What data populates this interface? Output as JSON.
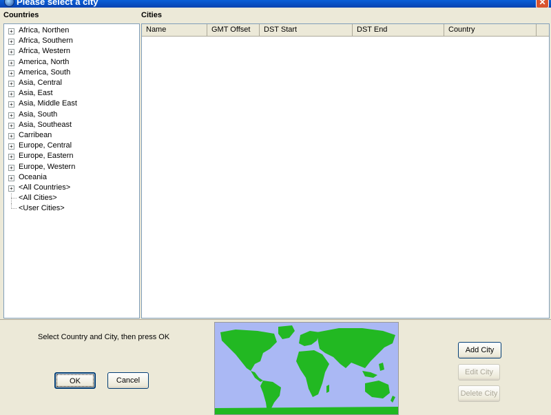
{
  "window": {
    "title": "Please select a city",
    "close_label": "✕"
  },
  "countries_pane": {
    "label": "Countries",
    "items": [
      {
        "label": "Africa, Northen",
        "expandable": true
      },
      {
        "label": "Africa, Southern",
        "expandable": true
      },
      {
        "label": "Africa, Western",
        "expandable": true
      },
      {
        "label": "America, North",
        "expandable": true
      },
      {
        "label": "America, South",
        "expandable": true
      },
      {
        "label": "Asia, Central",
        "expandable": true
      },
      {
        "label": "Asia, East",
        "expandable": true
      },
      {
        "label": "Asia, Middle East",
        "expandable": true
      },
      {
        "label": "Asia, South",
        "expandable": true
      },
      {
        "label": "Asia, Southeast",
        "expandable": true
      },
      {
        "label": "Carribean",
        "expandable": true
      },
      {
        "label": "Europe, Central",
        "expandable": true
      },
      {
        "label": "Europe, Eastern",
        "expandable": true
      },
      {
        "label": "Europe, Western",
        "expandable": true
      },
      {
        "label": "Oceania",
        "expandable": true
      },
      {
        "label": "<All Countries>",
        "expandable": true
      },
      {
        "label": "<All Cities>",
        "expandable": false
      },
      {
        "label": "<User Cities>",
        "expandable": false
      }
    ],
    "expander_glyph": "+"
  },
  "cities_pane": {
    "label": "Cities",
    "columns": [
      "Name",
      "GMT Offset",
      "DST Start",
      "DST End",
      "Country"
    ],
    "rows": []
  },
  "footer": {
    "hint": "Select Country and City, then press OK",
    "ok_label": "OK",
    "cancel_label": "Cancel",
    "add_city_label": "Add City",
    "edit_city_label": "Edit City",
    "delete_city_label": "Delete City"
  },
  "map": {
    "ocean_color": "#aab8f4",
    "land_color": "#22b822",
    "icon": "world-map"
  }
}
